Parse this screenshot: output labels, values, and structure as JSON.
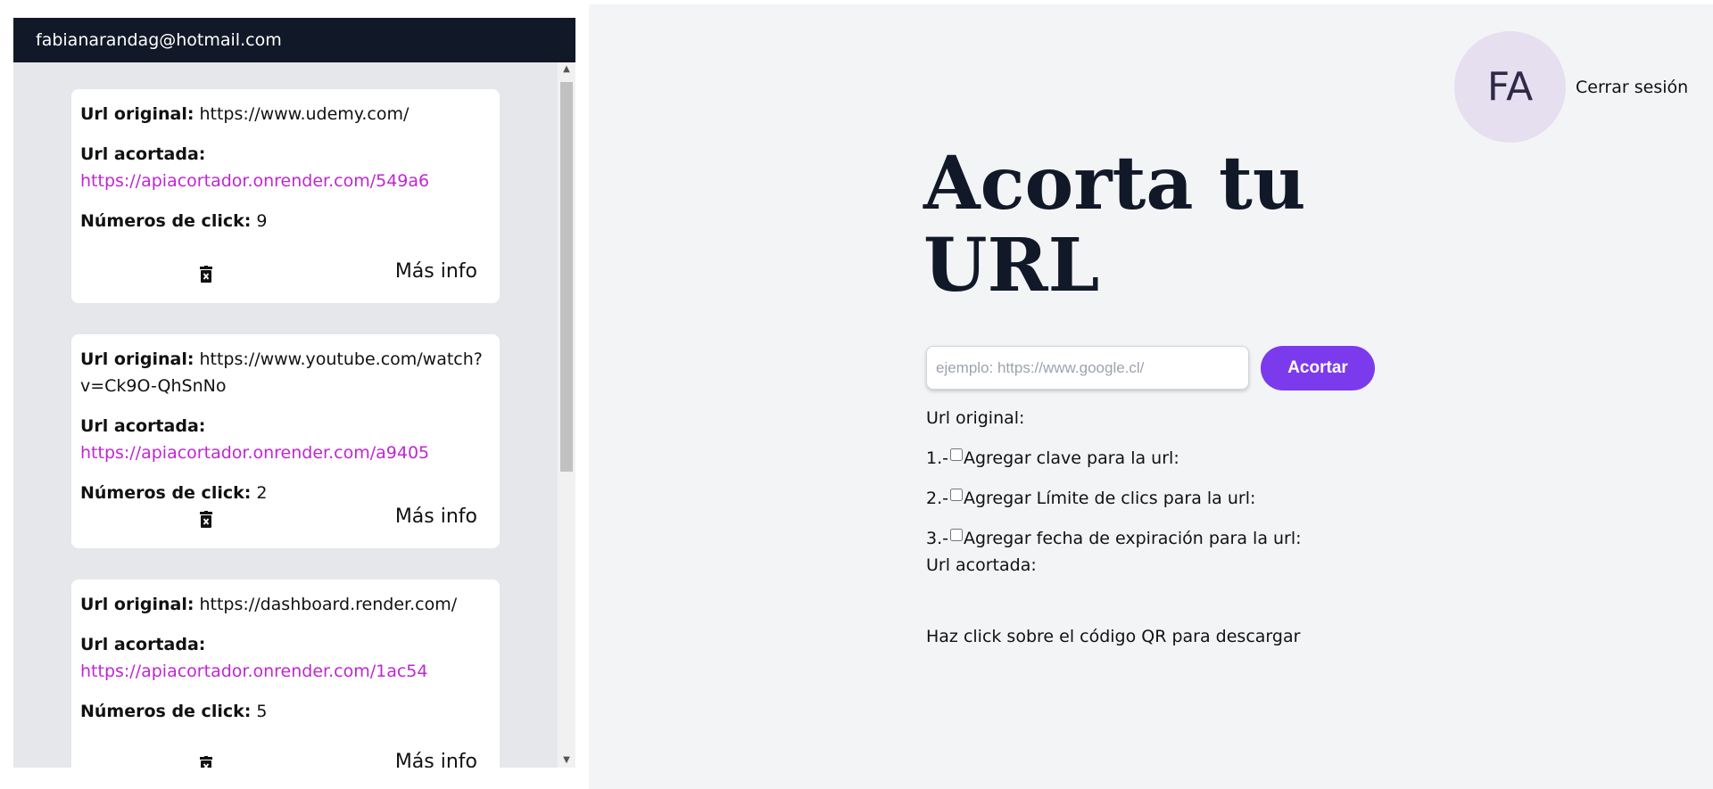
{
  "user": {
    "email": "fabianarandag@hotmail.com",
    "initials": "FA"
  },
  "urls": [
    {
      "original_label": "Url original:",
      "original_value": "https://www.udemy.com/",
      "short_label": "Url acortada:",
      "short_value": "https://apiacortador.onrender.com/549a6",
      "clicks_label": "Números de click:",
      "clicks_value": "9",
      "more_label": "Más info"
    },
    {
      "original_label": "Url original:",
      "original_value": "https://www.youtube.com/watch?v=Ck9O-QhSnNo",
      "short_label": "Url acortada:",
      "short_value": "https://apiacortador.onrender.com/a9405",
      "clicks_label": "Números de click:",
      "clicks_value": "2",
      "more_label": "Más info"
    },
    {
      "original_label": "Url original:",
      "original_value": "https://dashboard.render.com/",
      "short_label": "Url acortada:",
      "short_value": "https://apiacortador.onrender.com/1ac54",
      "clicks_label": "Números de click:",
      "clicks_value": "5",
      "more_label": "Más info"
    }
  ],
  "header": {
    "logout": "Cerrar sesión"
  },
  "main": {
    "title_line1": "Acorta tu",
    "title_line2": "URL",
    "input_placeholder": "ejemplo: https://www.google.cl/",
    "submit_label": "Acortar",
    "original_label": "Url original:",
    "options": [
      {
        "prefix": "1.-",
        "label": "Agregar clave para la url:"
      },
      {
        "prefix": "2.-",
        "label": "Agregar Límite de clics para la url:"
      },
      {
        "prefix": "3.-",
        "label": "Agregar fecha de expiración para la url:"
      }
    ],
    "short_label": "Url acortada:",
    "qr_hint": "Haz click sobre el código QR para descargar"
  },
  "colors": {
    "header_bg": "#111827",
    "accent": "#7c3aed",
    "link": "#c026d3",
    "avatar_bg": "#e5dff0"
  },
  "icons": {
    "delete": "trash-icon",
    "scroll_up": "arrow-up-icon",
    "scroll_down": "arrow-down-icon"
  }
}
